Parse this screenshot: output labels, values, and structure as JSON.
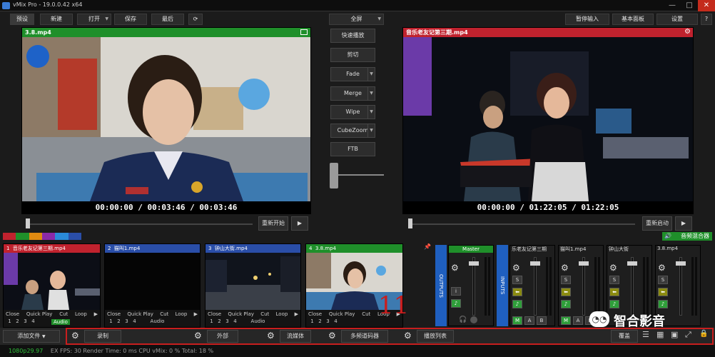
{
  "window": {
    "title": "vMix Pro - 19.0.0.42 x64",
    "min": "—",
    "max": "□",
    "close": "✕"
  },
  "menu": {
    "preset": "预设",
    "new": "新建",
    "open": "打开",
    "save": "保存",
    "last": "最后",
    "fullscreen": "全屏",
    "pause_input": "暂停输入",
    "basic_panel": "基本面板",
    "settings": "设置",
    "help": "?"
  },
  "preview": {
    "title": "3.8.mp4",
    "timecode": "00:00:00  /  00:03:46  /  00:03:46",
    "restart": "重新开始"
  },
  "output": {
    "title": "音乐老友记第三期.mp4",
    "timecode": "00:00:00  /  01:22:05  /  01:22:05",
    "restart": "重新启动"
  },
  "transitions": {
    "quick_play": "快速播放",
    "cut": "剪切",
    "fade": "Fade",
    "merge": "Merge",
    "wipe": "Wipe",
    "cubezoom": "CubeZoom",
    "ftb": "FTB"
  },
  "colors": [
    "#c0222e",
    "#1f8f2a",
    "#e08a10",
    "#8a2aa8",
    "#2a8ad8",
    "#2a4ea8"
  ],
  "audio_mixer_label": "音频混合器",
  "inputs": [
    {
      "num": "1",
      "name": "音乐老友记第三期.mp4",
      "bar": "red"
    },
    {
      "num": "2",
      "name": "猫叫1.mp4",
      "bar": "blue"
    },
    {
      "num": "3",
      "name": "钟山大街.mp4",
      "bar": "blue"
    },
    {
      "num": "4",
      "name": "3.8.mp4",
      "bar": "green"
    }
  ],
  "input_controls": {
    "close": "Close",
    "quick_play": "Quick Play",
    "cut": "Cut",
    "loop": "Loop",
    "n1": "1",
    "n2": "2",
    "n3": "3",
    "n4": "4",
    "audio": "Audio"
  },
  "mixer": {
    "outputs": "OUTPUTS",
    "inputs": "INPUTS",
    "master": "Master",
    "ch1": "乐老友记第三期",
    "ch2": "猫叫1.mp4",
    "ch3": "钟山大街",
    "ch4": "3.8.mp4",
    "s": "S",
    "m": "M",
    "a": "A",
    "b": "B",
    "i": "i"
  },
  "bottom": {
    "add_input": "添加文件",
    "record": "录制",
    "external": "外部",
    "stream": "流媒体",
    "multicorder": "多频道码器",
    "playlist": "播放列表",
    "overlay": "覆盖"
  },
  "status": {
    "res": "1080p29.97",
    "text": "EX  FPS: 30  Render Time: 0 ms  CPU vMix: 0 %  Total: 18 %"
  },
  "annotation": {
    "number": "11"
  },
  "watermark": {
    "text": "智合影音"
  }
}
